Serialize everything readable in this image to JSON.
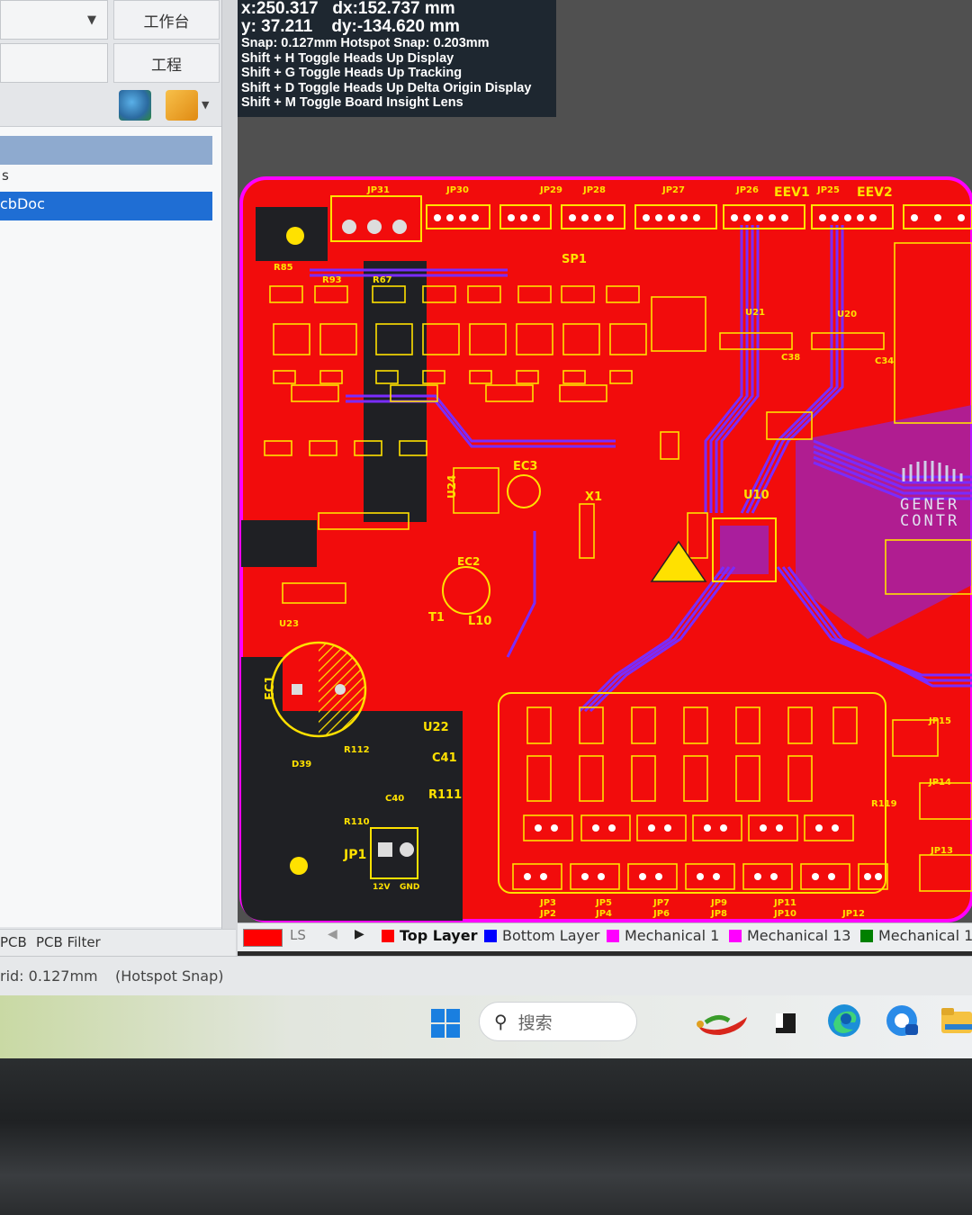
{
  "toolbar": {
    "workbench_label": "工作台",
    "project_label": "工程"
  },
  "projects_panel": {
    "item_partial": "s",
    "selected_doc": "cbDoc"
  },
  "panel_tabs": [
    "PCB",
    "PCB Filter"
  ],
  "hud": {
    "x": "x:250.317",
    "dx": "dx:152.737  mm",
    "y": "y: 37.211",
    "dy": "dy:-134.620 mm",
    "snap": "Snap: 0.127mm Hotspot Snap: 0.203mm",
    "shortcuts": [
      "Shift + H  Toggle Heads Up Display",
      "Shift + G  Toggle Heads Up Tracking",
      "Shift + D  Toggle Heads Up Delta Origin Display",
      "Shift + M  Toggle Board Insight Lens"
    ]
  },
  "layer_bar": {
    "ls_label": "LS",
    "layers": [
      {
        "name": "Top Layer",
        "color": "#ff0000",
        "active": true
      },
      {
        "name": "Bottom Layer",
        "color": "#0000ff"
      },
      {
        "name": "Mechanical 1",
        "color": "#ff00ff"
      },
      {
        "name": "Mechanical 13",
        "color": "#ff00ff"
      },
      {
        "name": "Mechanical 1",
        "color": "#008000"
      }
    ]
  },
  "status_bar": {
    "grid": "rid: 0.127mm",
    "snap": "(Hotspot Snap)"
  },
  "taskbar": {
    "search_placeholder": "搜索"
  },
  "pcb": {
    "colors": {
      "board": "#f20c0c",
      "background": "#1f2024",
      "silk": "#ffe100",
      "bottom_trace": "#7a2cff",
      "mech": "#ff00ff"
    },
    "top_labels": [
      "JP31",
      "JP30",
      "JP29",
      "JP28",
      "JP27",
      "JP26",
      "EEV1",
      "JP25",
      "EEV2"
    ],
    "component_labels": [
      "SP1",
      "U21",
      "U20",
      "EC3",
      "X1",
      "U10",
      "EC2",
      "T1",
      "L10",
      "EC1",
      "U22",
      "R112",
      "C41",
      "R111",
      "C40",
      "R110",
      "JP1",
      "D39",
      "R119",
      "JP15",
      "JP14",
      "JP13",
      "U24",
      "U23",
      "C38",
      "C34",
      "R85",
      "R93",
      "R67"
    ],
    "bottom_labels": [
      "JP3",
      "JP2",
      "JP5",
      "JP4",
      "JP7",
      "JP6",
      "JP9",
      "JP8",
      "JP11",
      "JP10",
      "JP12"
    ],
    "jp1_pins": [
      "12V",
      "GND"
    ],
    "logo_text": [
      "GENER",
      "CONTR"
    ]
  }
}
